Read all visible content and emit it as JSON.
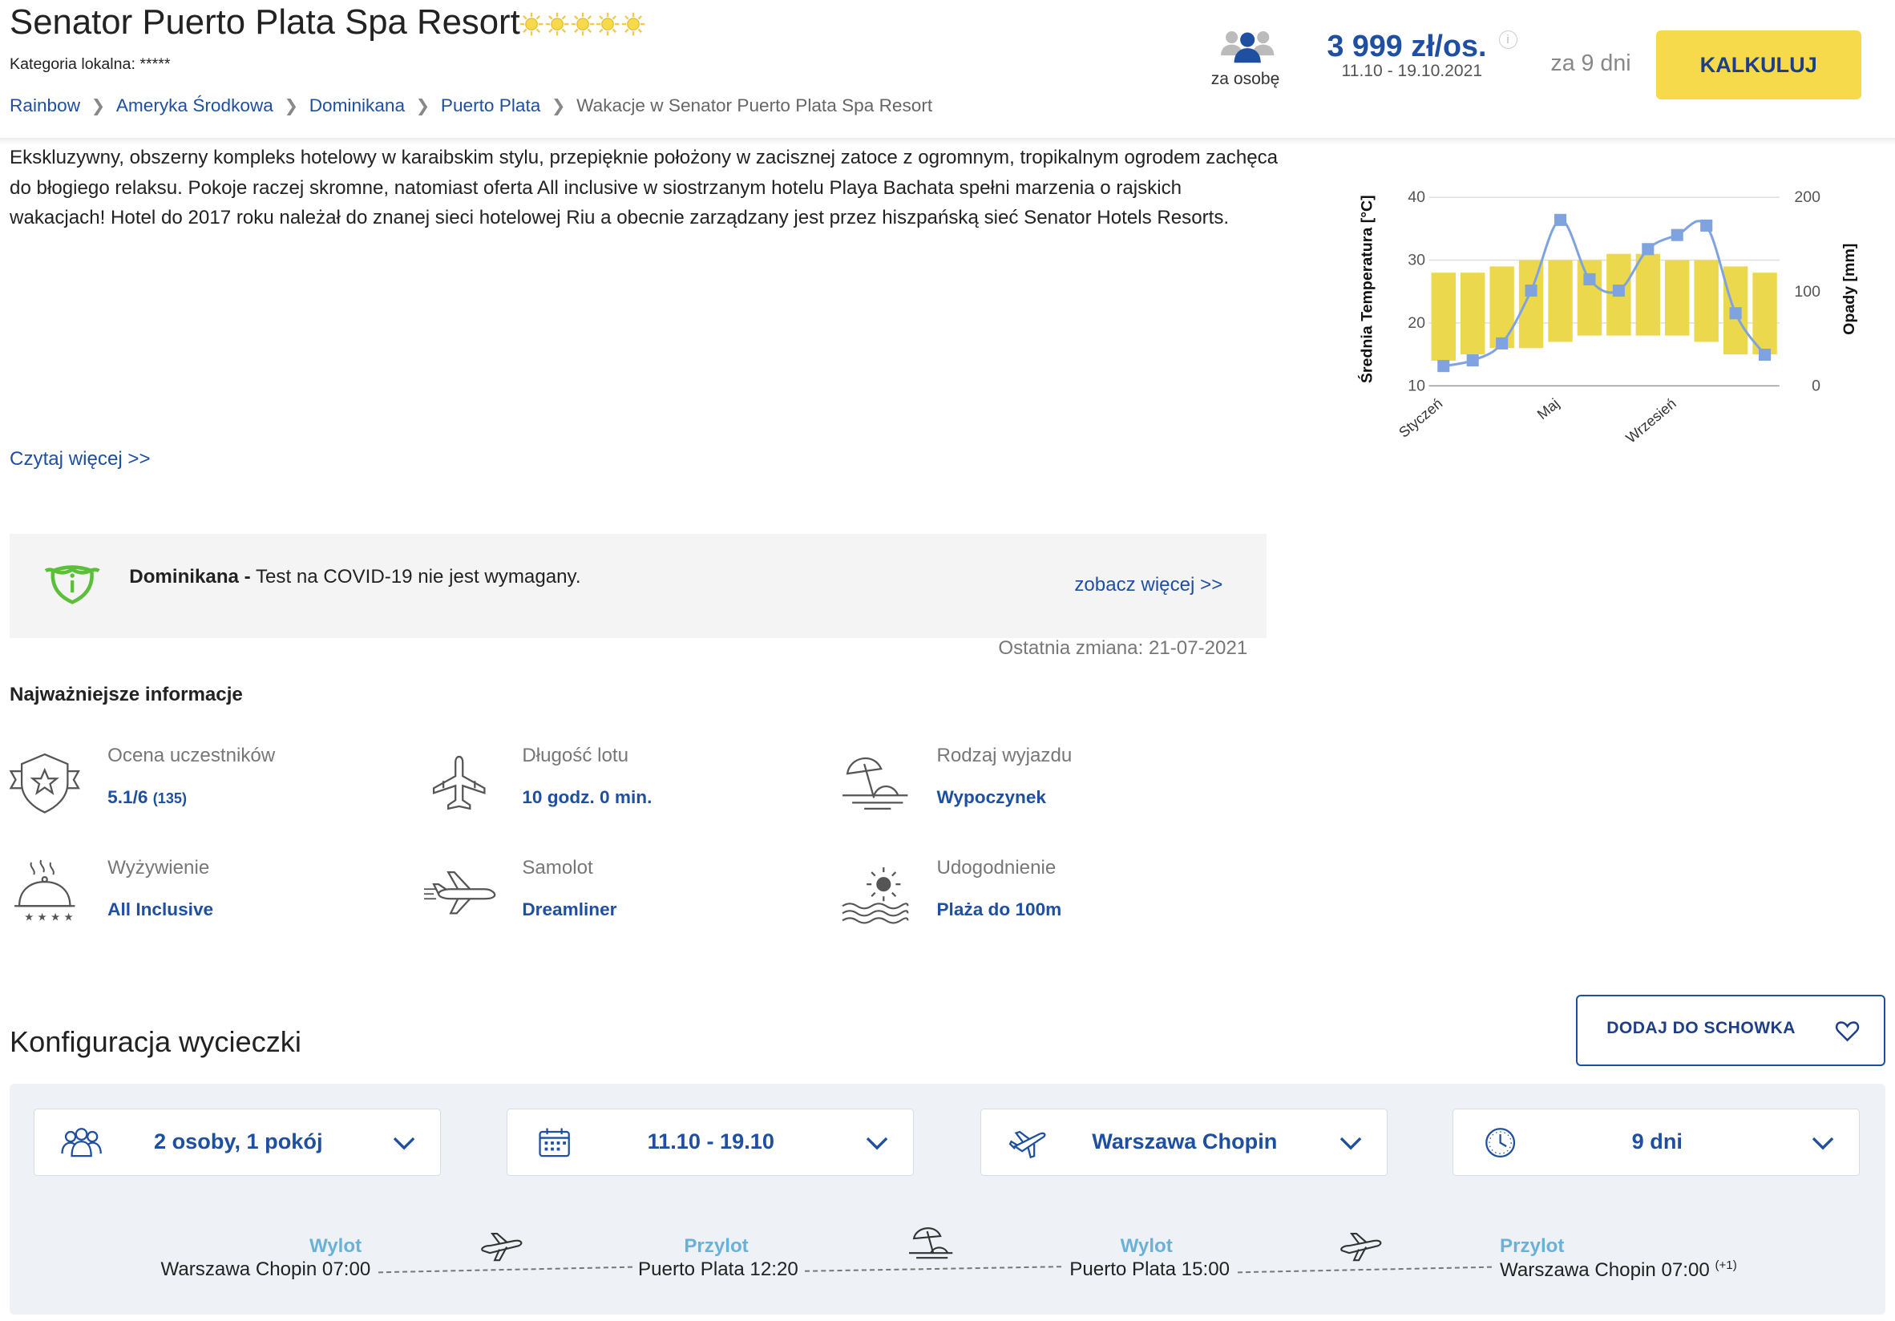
{
  "header": {
    "hotel_name": "Senator Puerto Plata Spa Resort",
    "star_rating": 5,
    "local_category": "Kategoria lokalna: *****",
    "breadcrumb": [
      "Rainbow",
      "Ameryka Środkowa",
      "Dominikana",
      "Puerto Plata",
      "Wakacje w Senator Puerto Plata Spa Resort"
    ]
  },
  "price_box": {
    "per_person_label": "za osobę",
    "price": "3 999 zł/os.",
    "dates": "11.10 - 19.10.2021",
    "info_icon": "i",
    "duration": "za 9 dni",
    "button_label": "KALKULUJ"
  },
  "description": {
    "text": "Ekskluzywny, obszerny kompleks hotelowy w karaibskim stylu, przepięknie położony w zacisznej zatoce z ogromnym, tropikalnym ogrodem zachęca do błogiego relaksu. Pokoje raczej skromne, natomiast oferta All inclusive w siostrzanym hotelu Playa Bachata spełni marzenia o rajskich wakacjach! Hotel do 2017 roku należał do znanej sieci hotelowej Riu a obecnie zarządzany jest przez hiszpańską sieć Senator Hotels   Resorts.",
    "read_more": "Czytaj więcej >>"
  },
  "covid": {
    "country": "Dominikana -",
    "message": " Test na COVID-19 nie jest wymagany.",
    "more_link": "zobacz więcej >>",
    "last_change": "Ostatnia zmiana: 21-07-2021"
  },
  "key_info": {
    "heading": "Najważniejsze informacje",
    "items": [
      {
        "label": "Ocena uczestników",
        "value": "5.1/6",
        "extra": "(135)",
        "icon": "badge-star-icon"
      },
      {
        "label": "Długość lotu",
        "value": "10 godz. 0 min.",
        "icon": "plane-top-icon"
      },
      {
        "label": "Rodzaj wyjazdu",
        "value": "Wypoczynek",
        "icon": "beach-umbrella-icon"
      },
      {
        "label": "Wyżywienie",
        "value": "All Inclusive",
        "icon": "cloche-icon"
      },
      {
        "label": "Samolot",
        "value": "Dreamliner",
        "icon": "plane-side-icon"
      },
      {
        "label": "Udogodnienie",
        "value": "Plaża do 100m",
        "icon": "sun-sea-icon"
      }
    ]
  },
  "config": {
    "title": "Konfiguracja wycieczki",
    "save_button": "DODAJ DO SCHOWKA",
    "selectors": [
      {
        "value": "2 osoby, 1 pokój",
        "icon": "people-icon"
      },
      {
        "value": "11.10 - 19.10",
        "icon": "calendar-icon"
      },
      {
        "value": "Warszawa Chopin",
        "icon": "plane-icon"
      },
      {
        "value": "9 dni",
        "icon": "clock-icon"
      }
    ],
    "legs": [
      {
        "head": "Wylot",
        "place": "Warszawa Chopin 07:00"
      },
      {
        "head": "Przylot",
        "place": "Puerto Plata 12:20"
      },
      {
        "head": "Wylot",
        "place": "Puerto Plata 15:00"
      },
      {
        "head": "Przylot",
        "place": "Warszawa Chopin 07:00",
        "extra": "(+1)"
      }
    ]
  },
  "colors": {
    "accent": "#1e4fa0",
    "button": "#f7d94c",
    "bar": "#ecd84c",
    "line": "#7fa3e0"
  },
  "chart_data": {
    "type": "bar",
    "ylabel": "Średnia Temperatura [°C]",
    "y2label": "Opady [mm]",
    "ylim": [
      10,
      40
    ],
    "y2lim": [
      0,
      200
    ],
    "yticks": [
      10,
      20,
      30,
      40
    ],
    "y2ticks": [
      0,
      100,
      200
    ],
    "xtick_labels": [
      "Styczeń",
      "Maj",
      "Wrzesień"
    ],
    "categories": [
      "1",
      "2",
      "3",
      "4",
      "5",
      "6",
      "7",
      "8",
      "9",
      "10",
      "11",
      "12"
    ],
    "temp_min": [
      14,
      15,
      16,
      16,
      17,
      18,
      18,
      18,
      18,
      17,
      15,
      15
    ],
    "temp_max": [
      28,
      28,
      29,
      30,
      30,
      30,
      31,
      31,
      30,
      30,
      29,
      28
    ],
    "precip": [
      21,
      27,
      45,
      101,
      176,
      113,
      101,
      145,
      160,
      170,
      77,
      33
    ]
  }
}
